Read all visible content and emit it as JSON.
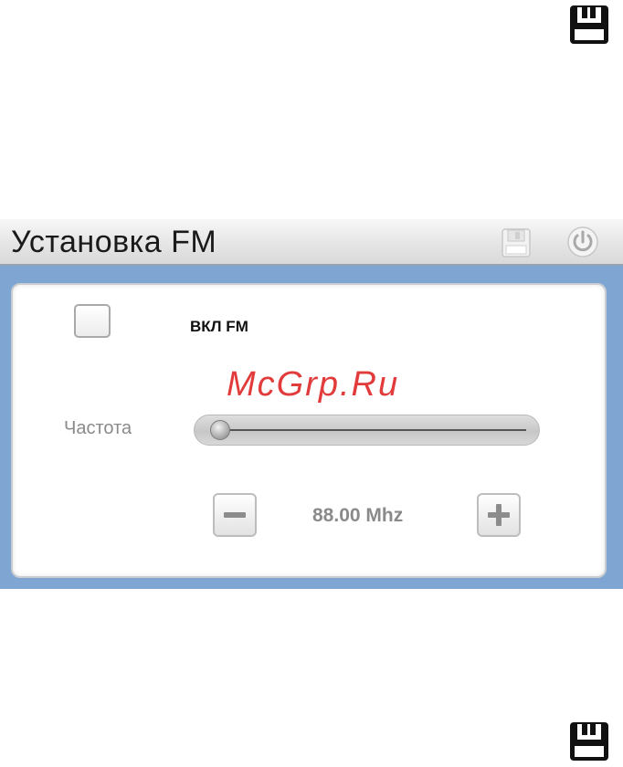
{
  "header": {
    "title": "Установка FM"
  },
  "icons": {
    "floppy": "floppy-disk-icon",
    "power": "power-icon",
    "minus": "minus-icon",
    "plus": "plus-icon"
  },
  "fm": {
    "enable_label": "ВКЛ FM",
    "enabled": false
  },
  "frequency": {
    "label": "Частота",
    "value_text": "88.00 Mhz",
    "slider_level_percent": 0
  },
  "watermark": "McGrp.Ru",
  "colors": {
    "frame": "#7fa6d2",
    "watermark": "#e23b3b",
    "label_gray": "#8a8a8a"
  }
}
